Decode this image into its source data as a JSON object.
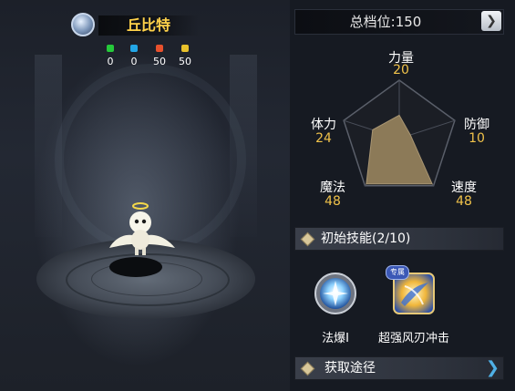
{
  "pet": {
    "name": "丘比特",
    "stats": [
      {
        "color": "#25c93a",
        "value": "0"
      },
      {
        "color": "#23a6e6",
        "value": "0"
      },
      {
        "color": "#e8512d",
        "value": "50"
      },
      {
        "color": "#e8c12b",
        "value": "50"
      }
    ]
  },
  "rating": {
    "label": "总档位:150"
  },
  "attributes": {
    "strength": {
      "label": "力量",
      "value": 20
    },
    "defense": {
      "label": "防御",
      "value": 10
    },
    "speed": {
      "label": "速度",
      "value": 48
    },
    "magic": {
      "label": "魔法",
      "value": 48
    },
    "stamina": {
      "label": "体力",
      "value": 24
    }
  },
  "skills": {
    "header": "初始技能(2/10)",
    "items": [
      {
        "name": "法爆I",
        "icon": "burst-orb-icon"
      },
      {
        "name": "超强风刃冲击",
        "icon": "wind-blade-icon",
        "badge": "专属"
      }
    ]
  },
  "obtain": {
    "label": "获取途径"
  }
}
